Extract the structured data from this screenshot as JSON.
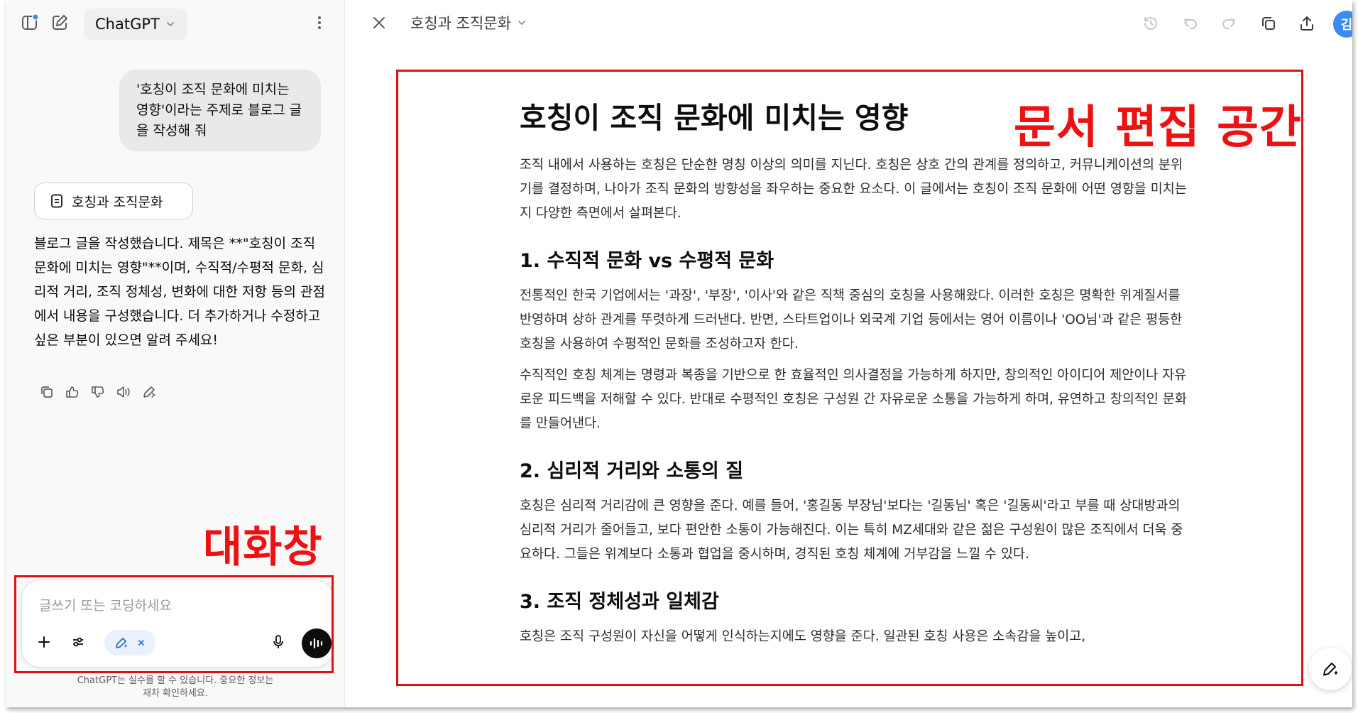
{
  "chat": {
    "model_name": "ChatGPT",
    "user_message": "'호칭이 조직 문화에 미치는 영향'이라는 주제로 블로그 글을 작성해 줘",
    "canvas_chip_label": "호칭과 조직문화",
    "assistant_message": "블로그 글을 작성했습니다. 제목은 **\"호칭이 조직 문화에 미치는 영향\"**이며, 수직적/수평적 문화, 심리적 거리, 조직 정체성, 변화에 대한 저항 등의 관점에서 내용을 구성했습니다. 더 추가하거나 수정하고 싶은 부분이 있으면 알려 주세요!",
    "composer_placeholder": "글쓰기 또는 코딩하세요",
    "disclaimer_line1": "ChatGPT는 실수를 할 수 있습니다. 중요한 정보는",
    "disclaimer_line2": "재차 확인하세요."
  },
  "annotations": {
    "chat_label": "대화창",
    "doc_label": "문서 편집 공간",
    "color": "#ee1111"
  },
  "document": {
    "header_title": "호칭과 조직문화",
    "avatar_initial": "김",
    "title": "호칭이 조직 문화에 미치는 영향",
    "intro": "조직 내에서 사용하는 호칭은 단순한 명칭 이상의 의미를 지닌다. 호칭은 상호 간의 관계를 정의하고, 커뮤니케이션의 분위기를 결정하며, 나아가 조직 문화의 방향성을 좌우하는 중요한 요소다. 이 글에서는 호칭이 조직 문화에 어떤 영향을 미치는지 다양한 측면에서 살펴본다.",
    "section1_title": "1. 수직적 문화 vs 수평적 문화",
    "section1_p1": "전통적인 한국 기업에서는 '과장', '부장', '이사'와 같은 직책 중심의 호칭을 사용해왔다. 이러한 호칭은 명확한 위계질서를 반영하며 상하 관계를 뚜렷하게 드러낸다. 반면, 스타트업이나 외국계 기업 등에서는 영어 이름이나 'OO님'과 같은 평등한 호칭을 사용하여 수평적인 문화를 조성하고자 한다.",
    "section1_p2": "수직적인 호칭 체계는 명령과 복종을 기반으로 한 효율적인 의사결정을 가능하게 하지만, 창의적인 아이디어 제안이나 자유로운 피드백을 저해할 수 있다. 반대로 수평적인 호칭은 구성원 간 자유로운 소통을 가능하게 하며, 유연하고 창의적인 문화를 만들어낸다.",
    "section2_title": "2. 심리적 거리와 소통의 질",
    "section2_p1": "호칭은 심리적 거리감에 큰 영향을 준다. 예를 들어, '홍길동 부장님'보다는 '길동님' 혹은 '길동씨'라고 부를 때 상대방과의 심리적 거리가 줄어들고, 보다 편안한 소통이 가능해진다. 이는 특히 MZ세대와 같은 젊은 구성원이 많은 조직에서 더욱 중요하다. 그들은 위계보다 소통과 협업을 중시하며, 경직된 호칭 체계에 거부감을 느낄 수 있다.",
    "section3_title": "3. 조직 정체성과 일체감",
    "section3_p1": "호칭은 조직 구성원이 자신을 어떻게 인식하는지에도 영향을 준다. 일관된 호칭 사용은 소속감을 높이고,"
  }
}
